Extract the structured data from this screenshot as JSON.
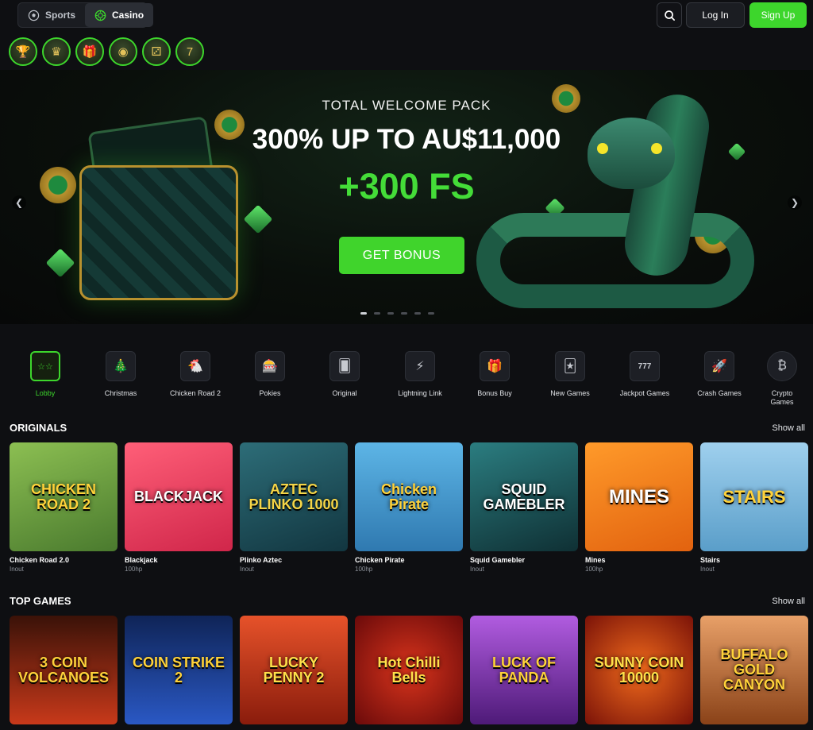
{
  "header": {
    "tabs": [
      {
        "label": "Sports",
        "icon": "soccer-ball-icon",
        "active": false
      },
      {
        "label": "Casino",
        "icon": "casino-chip-icon",
        "active": true
      }
    ],
    "search_icon": "search-icon",
    "login_label": "Log In",
    "signup_label": "Sign Up"
  },
  "promo_icons": [
    {
      "name": "trophy-icon",
      "glyph": "🏆"
    },
    {
      "name": "crown-icon",
      "glyph": "♛"
    },
    {
      "name": "gift-icon",
      "glyph": "🎁"
    },
    {
      "name": "chip-icon",
      "glyph": "◉"
    },
    {
      "name": "dice-icon",
      "glyph": "⚂"
    },
    {
      "name": "seven-icon",
      "glyph": "7"
    }
  ],
  "hero": {
    "subtitle": "TOTAL WELCOME PACK",
    "title": "300% UP TO AU$11,000",
    "free_spins": "+300 FS",
    "cta_label": "GET BONUS",
    "slides": 6,
    "active_slide": 0
  },
  "categories": [
    {
      "label": "Lobby",
      "icon": "stars-icon",
      "glyph": "☆☆",
      "active": true
    },
    {
      "label": "Christmas",
      "icon": "christmas-tree-icon",
      "glyph": "🎄",
      "active": false
    },
    {
      "label": "Chicken Road 2",
      "icon": "chicken-icon",
      "glyph": "🐔",
      "active": false
    },
    {
      "label": "Pokies",
      "icon": "slot-machine-icon",
      "glyph": "🎰",
      "active": false
    },
    {
      "label": "Original",
      "icon": "cards-icon",
      "glyph": "🂠",
      "active": false
    },
    {
      "label": "Lightning Link",
      "icon": "lightning-icon",
      "glyph": "⚡",
      "active": false
    },
    {
      "label": "Bonus Buy",
      "icon": "gift-box-icon",
      "glyph": "🎁",
      "active": false
    },
    {
      "label": "New Games",
      "icon": "new-cards-icon",
      "glyph": "🃏",
      "active": false
    },
    {
      "label": "Jackpot Games",
      "icon": "triple-seven-icon",
      "glyph": "777",
      "active": false
    },
    {
      "label": "Crash Games",
      "icon": "rocket-icon",
      "glyph": "🚀",
      "active": false
    },
    {
      "label": "Crypto Games",
      "icon": "bitcoin-icon",
      "glyph": "₿",
      "active": false
    }
  ],
  "originals": {
    "title": "ORIGINALS",
    "show_all": "Show all",
    "games": [
      {
        "name": "Chicken Road 2.0",
        "provider": "Inout",
        "thumb_text": "CHICKEN ROAD 2",
        "bg": "#5b8a3c"
      },
      {
        "name": "Blackjack",
        "provider": "100hp",
        "thumb_text": "BLACKJACK",
        "bg": "#e03a58"
      },
      {
        "name": "Plinko Aztec",
        "provider": "Inout",
        "thumb_text": "AZTEC PLINKO 1000",
        "bg": "#1f4a57"
      },
      {
        "name": "Chicken Pirate",
        "provider": "100hp",
        "thumb_text": "Chicken Pirate",
        "bg": "#3f8fc0"
      },
      {
        "name": "Squid Gamebler",
        "provider": "Inout",
        "thumb_text": "SQUID GAMEBLER",
        "bg": "#1f5a5e"
      },
      {
        "name": "Mines",
        "provider": "100hp",
        "thumb_text": "MINES",
        "bg": "#f07a1a"
      },
      {
        "name": "Stairs",
        "provider": "Inout",
        "thumb_text": "STAIRS",
        "bg": "#78b3d6"
      }
    ]
  },
  "top_games": {
    "title": "TOP GAMES",
    "show_all": "Show all",
    "games": [
      {
        "thumb_text": "3 COIN VOLCANOES",
        "bg": "#b42a12"
      },
      {
        "thumb_text": "COIN STRIKE 2",
        "bg": "#1b3d8f"
      },
      {
        "thumb_text": "LUCKY PENNY 2",
        "bg": "#c9361a"
      },
      {
        "thumb_text": "Hot Chilli Bells",
        "bg": "#a81414"
      },
      {
        "thumb_text": "LUCK OF PANDA",
        "bg": "#7c2fa8"
      },
      {
        "thumb_text": "SUNNY COIN 10000",
        "bg": "#c43318"
      },
      {
        "thumb_text": "BUFFALO GOLD CANYON",
        "bg": "#b55f2c"
      }
    ]
  },
  "colors": {
    "accent_green": "#3dd62c",
    "background": "#0e0f12"
  }
}
